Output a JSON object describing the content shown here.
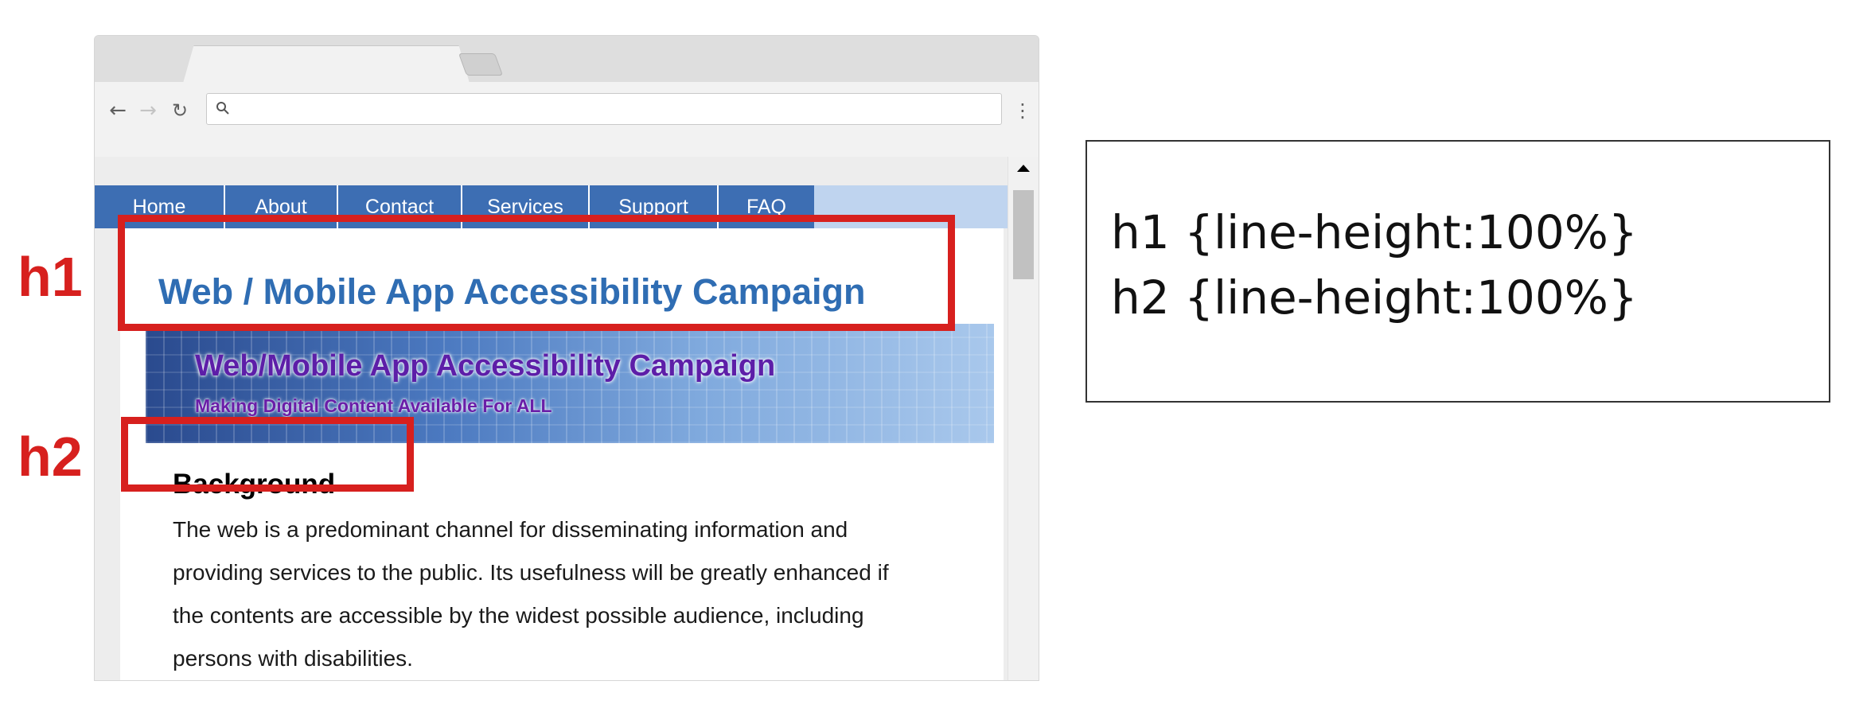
{
  "browser": {
    "address_value": "",
    "icons": {
      "back": "back-arrow-icon",
      "forward": "forward-arrow-icon",
      "reload": "reload-icon",
      "search": "search-icon",
      "menu": "menu-dots-icon"
    }
  },
  "nav": {
    "items": [
      {
        "label": "Home"
      },
      {
        "label": "About"
      },
      {
        "label": "Contact"
      },
      {
        "label": "Services"
      },
      {
        "label": "Support"
      },
      {
        "label": "FAQ"
      }
    ]
  },
  "page": {
    "h1": "Web / Mobile App Accessibility Campaign",
    "banner_title": "Web/Mobile App Accessibility Campaign",
    "banner_subtitle": "Making Digital Content Available For ALL",
    "h2": "Background",
    "paragraph_lines": [
      "The web is a predominant channel for disseminating information and",
      "providing services to the public. Its usefulness will be greatly enhanced if",
      "the contents are accessible by the widest possible audience, including",
      "persons with disabilities."
    ]
  },
  "annotations": {
    "h1_label": "h1",
    "h2_label": "h2",
    "color": "#d7201e"
  },
  "css_panel": {
    "lines": [
      "h1 {line-height:100%}",
      "h2 {line-height:100%}"
    ]
  },
  "colors": {
    "nav_bg": "#3d6eb3",
    "nav_strip": "#bfd4ef",
    "heading_blue": "#2f6db3",
    "banner_text": "#5d1ea8"
  }
}
